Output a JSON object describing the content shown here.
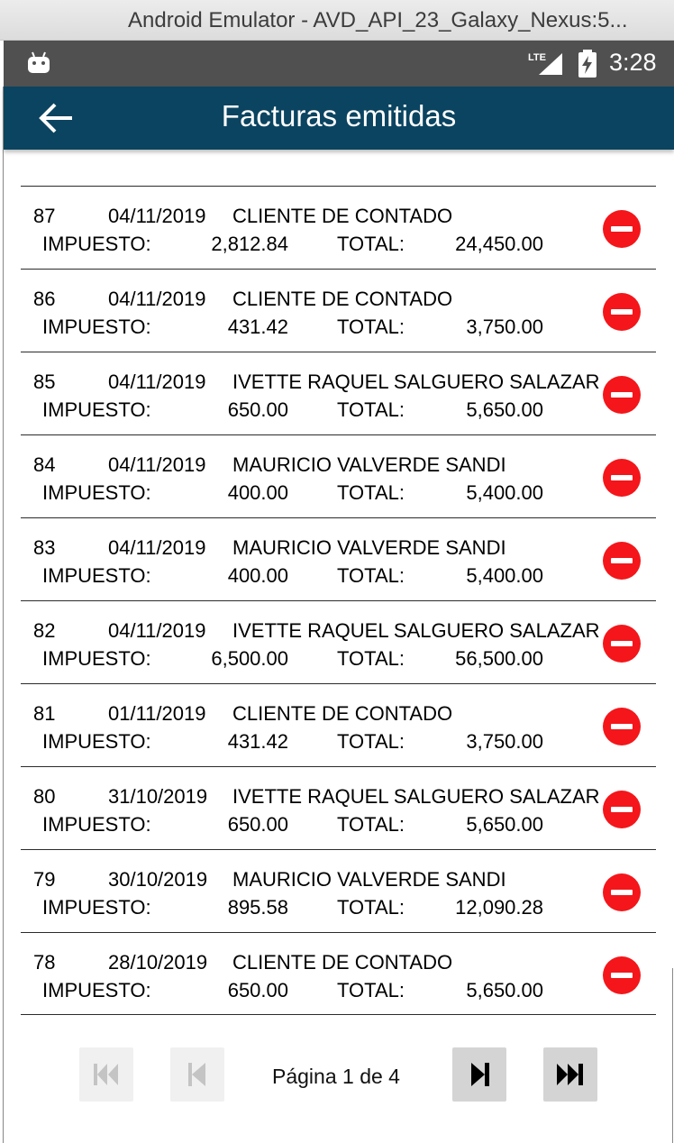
{
  "window": {
    "title": "Android Emulator - AVD_API_23_Galaxy_Nexus:5..."
  },
  "status_bar": {
    "time": "3:28",
    "network": "LTE",
    "icons": [
      "android-icon",
      "lte-signal-icon",
      "battery-charging-icon"
    ]
  },
  "app_bar": {
    "title": "Facturas emitidas",
    "back_icon": "arrow-left-icon"
  },
  "labels": {
    "tax": "IMPUESTO:",
    "total": "TOTAL:"
  },
  "invoices": [
    {
      "number": "87",
      "date": "04/11/2019",
      "client": "CLIENTE DE CONTADO",
      "tax": "2,812.84",
      "total": "24,450.00"
    },
    {
      "number": "86",
      "date": "04/11/2019",
      "client": "CLIENTE DE CONTADO",
      "tax": "431.42",
      "total": "3,750.00"
    },
    {
      "number": "85",
      "date": "04/11/2019",
      "client": "IVETTE RAQUEL SALGUERO SALAZAR",
      "tax": "650.00",
      "total": "5,650.00"
    },
    {
      "number": "84",
      "date": "04/11/2019",
      "client": "MAURICIO VALVERDE SANDI",
      "tax": "400.00",
      "total": "5,400.00"
    },
    {
      "number": "83",
      "date": "04/11/2019",
      "client": "MAURICIO VALVERDE SANDI",
      "tax": "400.00",
      "total": "5,400.00"
    },
    {
      "number": "82",
      "date": "04/11/2019",
      "client": "IVETTE RAQUEL SALGUERO SALAZAR",
      "tax": "6,500.00",
      "total": "56,500.00"
    },
    {
      "number": "81",
      "date": "01/11/2019",
      "client": "CLIENTE DE CONTADO",
      "tax": "431.42",
      "total": "3,750.00"
    },
    {
      "number": "80",
      "date": "31/10/2019",
      "client": "IVETTE RAQUEL SALGUERO SALAZAR",
      "tax": "650.00",
      "total": "5,650.00"
    },
    {
      "number": "79",
      "date": "30/10/2019",
      "client": "MAURICIO VALVERDE SANDI",
      "tax": "895.58",
      "total": "12,090.28"
    },
    {
      "number": "78",
      "date": "28/10/2019",
      "client": "CLIENTE DE CONTADO",
      "tax": "650.00",
      "total": "5,650.00"
    }
  ],
  "pager": {
    "label": "Página 1 de 4",
    "buttons": [
      {
        "name": "first-page-button",
        "icon": "skip-first-icon",
        "enabled": false
      },
      {
        "name": "previous-page-button",
        "icon": "skip-previous-icon",
        "enabled": false
      },
      {
        "name": "next-page-button",
        "icon": "skip-next-icon",
        "enabled": true
      },
      {
        "name": "last-page-button",
        "icon": "skip-last-icon",
        "enabled": true
      }
    ]
  },
  "colors": {
    "app_bar": "#0b4460",
    "status_bar": "#505050",
    "delete": "#f4161a",
    "pager_enabled": "#d4d4d4",
    "pager_disabled": "#f0f0f0"
  }
}
